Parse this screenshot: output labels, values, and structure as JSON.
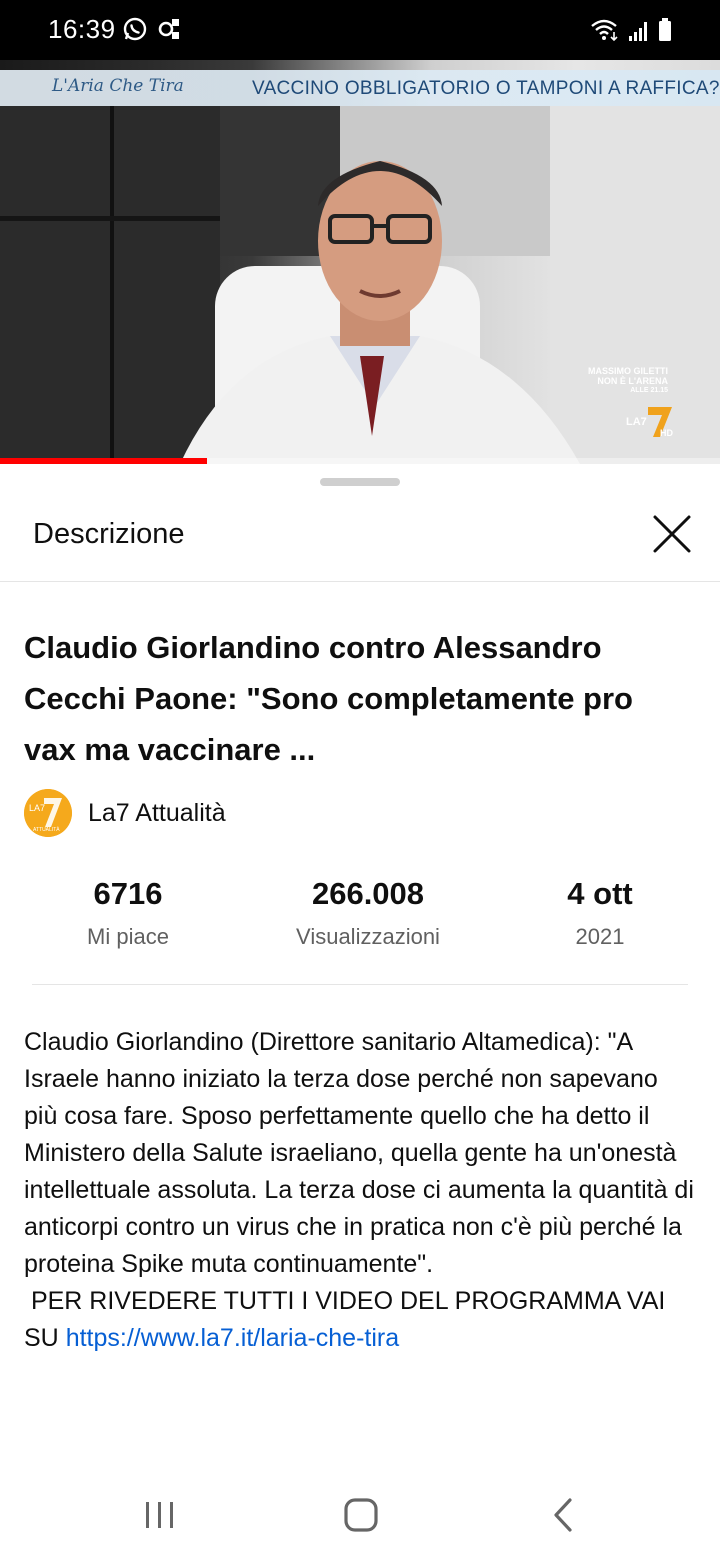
{
  "status_bar": {
    "time": "16:39",
    "left_icons": [
      "whatsapp-icon",
      "notification-app-icon"
    ],
    "right_icons": [
      "wifi-icon",
      "signal-icon",
      "battery-icon"
    ]
  },
  "video": {
    "banner_logo": "L'Aria Che Tira",
    "banner_title": "VACCINO OBBLIGATORIO O TAMPONI A RAFFICA?",
    "caption_line1": "MASSIMO GILETTI",
    "caption_line2": "NON È L'ARENA",
    "caption_line3": "ALLE 21.15",
    "channel_logo": "LA7",
    "hd": "HD",
    "progress_fraction": 0.287
  },
  "sheet": {
    "title": "Descrizione",
    "close_icon": "close-icon"
  },
  "video_info": {
    "title": "Claudio Giorlandino contro Alessandro Cecchi Paone: \"Sono completamente pro vax ma vaccinare ...",
    "channel_name": "La7 Attualità",
    "channel_avatar_text": "LA7",
    "channel_avatar_sub": "ATTUALITÀ"
  },
  "stats": {
    "likes_value": "6716",
    "likes_label": "Mi piace",
    "views_value": "266.008",
    "views_label": "Visualizzazioni",
    "date_value": "4 ott",
    "date_label": "2021"
  },
  "description": {
    "text": "Claudio Giorlandino (Direttore sanitario Altamedica): \"A Israele hanno iniziato la terza dose perché non sapevano più cosa fare. Sposo perfettamente quello che ha detto il Ministero della Salute israeliano, quella gente ha un'onestà intellettuale assoluta. La terza dose ci aumenta la quantità di anticorpi contro un virus che in pratica non c'è più perché la proteina Spike muta continuamente\".\n PER RIVEDERE TUTTI I VIDEO DEL PROGRAMMA VAI SU ",
    "link": "https://www.la7.it/laria-che-tira"
  },
  "nav_bar": {
    "icons": [
      "recent-apps-icon",
      "home-icon",
      "back-icon"
    ]
  },
  "colors": {
    "accent_red": "#ff0000",
    "link_blue": "#065fd4",
    "secondary_text": "#606060"
  }
}
